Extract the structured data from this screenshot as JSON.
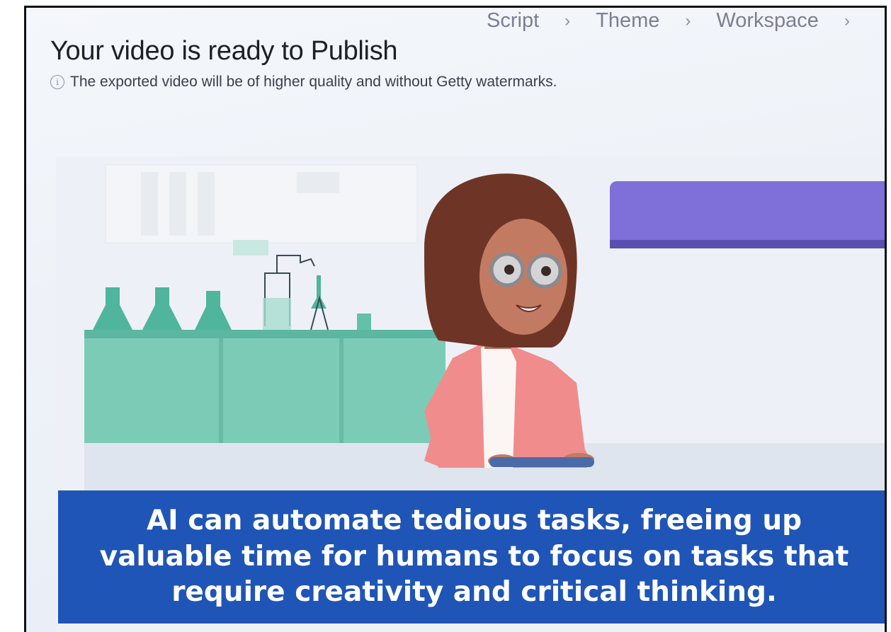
{
  "stepper": {
    "steps": [
      "Script",
      "Theme",
      "Workspace"
    ],
    "separator": "›"
  },
  "header": {
    "title": "Your video is ready to Publish",
    "notice": "The exported video will be of higher quality and without Getty watermarks.",
    "notice_icon": "info-icon"
  },
  "video": {
    "caption": "AI can automate tedious tasks, freeing up valuable time for humans to focus on tasks that require creativity and critical thinking.",
    "caption_bg": "#1f55b6",
    "accent": "#7e6fd9"
  }
}
